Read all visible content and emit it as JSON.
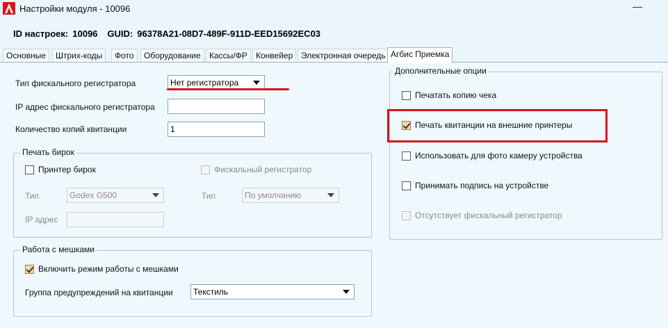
{
  "window": {
    "title": "Настройки модуля  - 10096",
    "app_icon": "A-logo-icon",
    "accent": "#d8141c"
  },
  "info": {
    "id_label": "ID настроек:",
    "id_value": "10096",
    "guid_label": "GUID:",
    "guid_value": "96378A21-08D7-489F-911D-EED15692EC03"
  },
  "tabs": [
    {
      "label": "Основные"
    },
    {
      "label": "Штрих-коды"
    },
    {
      "label": "Фото"
    },
    {
      "label": "Оборудование"
    },
    {
      "label": "Кассы/ФР"
    },
    {
      "label": "Конвейер"
    },
    {
      "label": "Электронная очередь"
    },
    {
      "label": "Агбис Приемка",
      "active": true
    }
  ],
  "left": {
    "fiscal_type_label": "Тип фискального регистратора",
    "fiscal_type_value": "Нет регистратора",
    "ip_label": "IP адрес фискального регистратора",
    "ip_value": "",
    "copies_label": "Количество копий квитанции",
    "copies_value": "1",
    "tags_group": {
      "title": "Печать бирок",
      "printer_label": "Принтер бирок",
      "printer_checked": false,
      "fiscal_label": "Фискальный регистратор",
      "fiscal_checked": false,
      "type1_label": "Тип",
      "type1_value": "Godex G500",
      "type2_label": "Тип",
      "type2_value": "По умолчанию",
      "ip_label": "IP адрес",
      "ip_value": ""
    },
    "bags_group": {
      "title": "Работа с мешками",
      "enable_label": "Включить режим работы с мешками",
      "enable_checked": true,
      "warn_label": "Группа предупреждений на квитанции",
      "warn_value": "Текстиль"
    }
  },
  "right": {
    "group_title": "Дополнительные опции",
    "options": [
      {
        "label": "Печатать копию чека",
        "checked": false,
        "enabled": true
      },
      {
        "label": "Печать квитанции на внешние принтеры",
        "checked": true,
        "enabled": true
      },
      {
        "label": "Использовать для фото камеру устройства",
        "checked": false,
        "enabled": true
      },
      {
        "label": "Принимать подпись на устройстве",
        "checked": false,
        "enabled": true
      },
      {
        "label": "Отсутствует фискальный регистратор",
        "checked": false,
        "enabled": false
      }
    ]
  }
}
